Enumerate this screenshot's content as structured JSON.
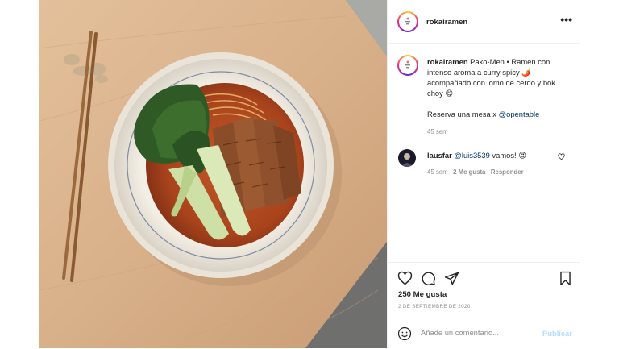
{
  "post": {
    "username": "rokairamen",
    "more_label": "•••",
    "caption": {
      "username": "rokairamen",
      "text_line1": "Pako-Men • Ramen con intenso aroma a curry spicy 🌶️ acompañado con lomo de cerdo y bok choy 😋",
      "dot": ".",
      "text_line2_prefix": "Reserva una mesa x ",
      "mention": "@opentable",
      "time": "45 sem"
    },
    "comment": {
      "username": "lausfar",
      "mention": "@luis3539",
      "text": " vamos! 😍",
      "time": "45 sem",
      "likes": "2 Me gusta",
      "reply": "Responder"
    },
    "likes": "250 Me gusta",
    "date": "2 DE SEPTIEMBRE DE 2020",
    "add_comment_placeholder": "Añade un comentario...",
    "publish_label": "Publicar"
  },
  "colors": {
    "mention": "#00376b",
    "muted": "#8e8e8e",
    "publish_disabled": "#b2dffc",
    "background_grey": "#9b9b97",
    "wood": "#d9b28c"
  },
  "icons": [
    "more-options-icon",
    "heart-icon",
    "comment-icon",
    "share-icon",
    "bookmark-icon",
    "emoji-icon",
    "small-heart-icon"
  ]
}
